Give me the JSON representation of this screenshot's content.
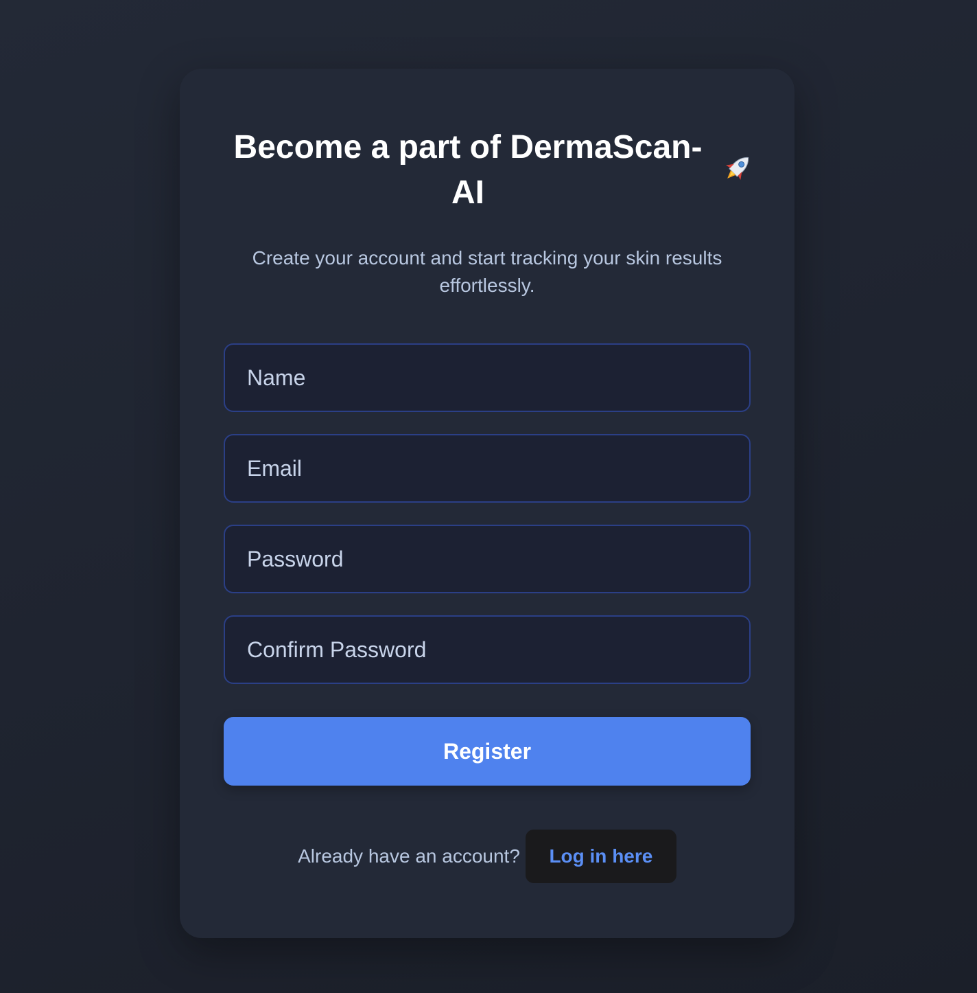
{
  "page": {
    "background_color": "#1f2430",
    "card_color": "#232937"
  },
  "header": {
    "title": "Become a part of DermaScan-AI",
    "title_icon": "rocket-icon",
    "subtitle": "Create your account and start tracking your skin results effortlessly."
  },
  "form": {
    "name_placeholder": "Name",
    "email_placeholder": "Email",
    "password_placeholder": "Password",
    "confirm_password_placeholder": "Confirm Password",
    "submit_label": "Register"
  },
  "footer": {
    "prompt": "Already have an account?",
    "login_label": "Log in here"
  },
  "colors": {
    "accent": "#4f82ee",
    "link": "#5b8ff5",
    "field_border": "#2b3f86"
  }
}
